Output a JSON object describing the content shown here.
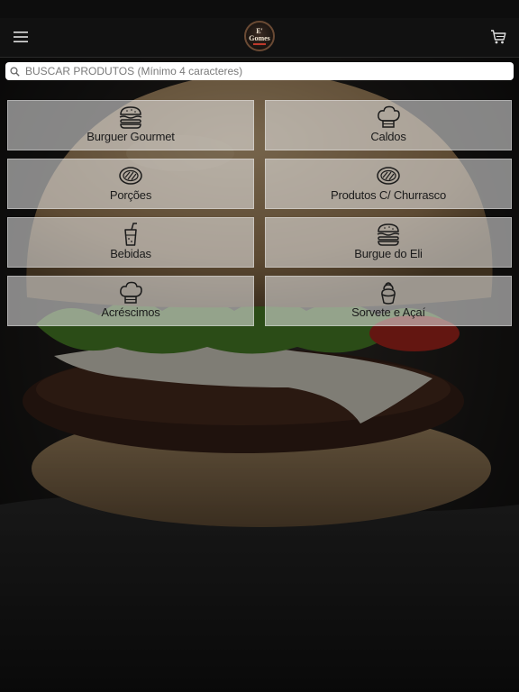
{
  "header": {
    "logo_text": "E'\nGomes",
    "menu_icon": "hamburger-menu-icon",
    "cart_icon": "shopping-cart-icon"
  },
  "search": {
    "placeholder": "BUSCAR PRODUTOS (Mínimo 4 caracteres)",
    "value": ""
  },
  "categories": [
    {
      "label": "Burguer Gourmet",
      "icon": "burger-icon"
    },
    {
      "label": "Caldos",
      "icon": "chef-hat-icon"
    },
    {
      "label": "Porções",
      "icon": "grill-meat-icon"
    },
    {
      "label": "Produtos C/ Churrasco",
      "icon": "grill-meat-icon"
    },
    {
      "label": "Bebidas",
      "icon": "drink-cup-icon"
    },
    {
      "label": "Burgue do Eli",
      "icon": "burger-icon"
    },
    {
      "label": "Acréscimos",
      "icon": "chef-hat-icon"
    },
    {
      "label": "Sorvete e Açaí",
      "icon": "ice-cream-icon"
    }
  ],
  "colors": {
    "header_bg": "#111111",
    "card_bg": "rgba(235,235,235,0.55)",
    "text": "#1b1b1b"
  }
}
